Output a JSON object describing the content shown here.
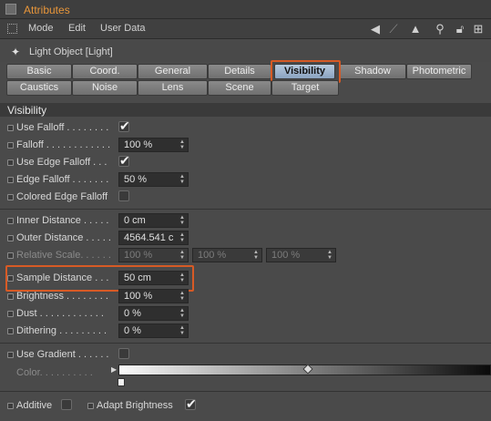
{
  "window": {
    "title": "Attributes"
  },
  "menu": {
    "items": [
      "Mode",
      "Edit",
      "User Data"
    ]
  },
  "object": {
    "title": "Light Object [Light]"
  },
  "tabs": {
    "row1": [
      "Basic",
      "Coord.",
      "General",
      "Details",
      "Visibility",
      "Shadow",
      "Photometric"
    ],
    "row2": [
      "Caustics",
      "Noise",
      "Lens",
      "Scene",
      "Target"
    ],
    "active": "Visibility"
  },
  "section": {
    "title": "Visibility"
  },
  "params": {
    "use_falloff": {
      "label": "Use Falloff . . . . . . . .",
      "checked": true
    },
    "falloff": {
      "label": "Falloff . . . . . . . . . . . .",
      "value": "100 %"
    },
    "use_edge_falloff": {
      "label": "Use Edge Falloff . . .",
      "checked": true
    },
    "edge_falloff": {
      "label": "Edge Falloff . . . . . . .",
      "value": "50 %"
    },
    "colored_edge_falloff": {
      "label": "Colored Edge Falloff",
      "checked": false
    },
    "inner_distance": {
      "label": "Inner Distance . . . . .",
      "value": "0 cm"
    },
    "outer_distance": {
      "label": "Outer Distance . . . . .",
      "value": "4564.541 c"
    },
    "relative_scale": {
      "label": "Relative Scale. . . . . .",
      "values": [
        "100 %",
        "100 %",
        "100 %"
      ]
    },
    "sample_distance": {
      "label": "Sample Distance . . .",
      "value": "50 cm"
    },
    "brightness": {
      "label": "Brightness . . . . . . . .",
      "value": "100 %"
    },
    "dust": {
      "label": "Dust . . . . . . . . . . . .",
      "value": "0 %"
    },
    "dithering": {
      "label": "Dithering . . . . . . . . .",
      "value": "0 %"
    },
    "use_gradient": {
      "label": "Use Gradient . . . . . .",
      "checked": false
    },
    "color": {
      "label": "Color. . . . . . . . . ."
    },
    "additive": {
      "label": "Additive",
      "checked": false
    },
    "adapt_brightness": {
      "label": "Adapt Brightness",
      "checked": true
    }
  },
  "colors": {
    "accent": "#e8963a",
    "highlight": "#d75a25",
    "active_tab": "#9fb6d0"
  }
}
